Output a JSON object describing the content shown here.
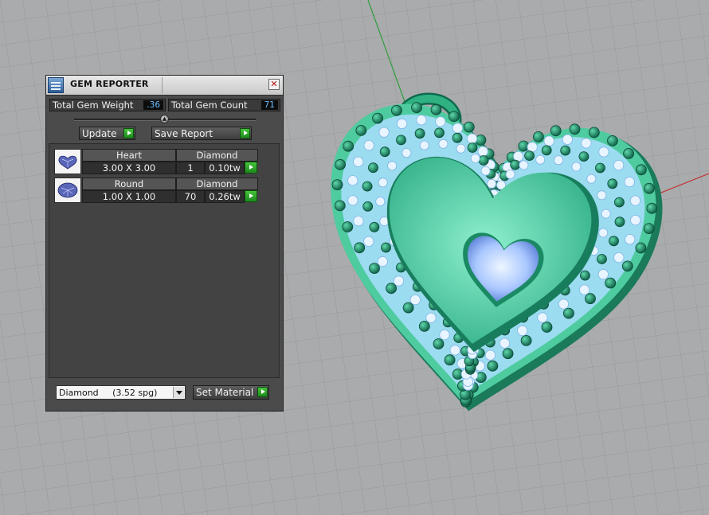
{
  "panel": {
    "title": "GEM REPORTER",
    "close_icon": "close-icon",
    "total_weight_label": "Total Gem Weight",
    "total_weight_value": ".36",
    "total_count_label": "Total Gem Count",
    "total_count_value": "71",
    "update_label": "Update",
    "save_report_label": "Save Report",
    "gems": [
      {
        "shape": "Heart",
        "size": "3.00 X 3.00",
        "material": "Diamond",
        "count": "1",
        "weight": "0.10tw",
        "icon": "heart-gem-icon"
      },
      {
        "shape": "Round",
        "size": "1.00 X 1.00",
        "material": "Diamond",
        "count": "70",
        "weight": "0.26tw",
        "icon": "round-gem-icon"
      }
    ],
    "material_select": "Diamond     (3.52 spg)",
    "set_material_label": "Set Material"
  },
  "colors": {
    "pendant_green": "#3fbf8f",
    "panel_bg": "#4b4b4b",
    "value_text": "#6fc0ff",
    "arrow_green": "#2aa82a",
    "gem_blue": "#8fb4ff"
  }
}
